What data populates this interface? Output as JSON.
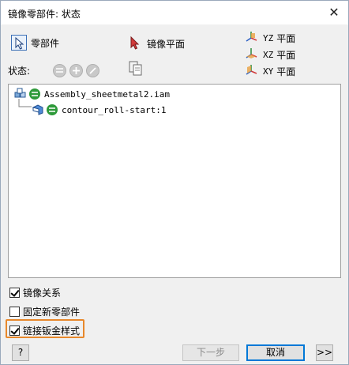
{
  "window": {
    "title": "镜像零部件: 状态",
    "close_glyph": "✕"
  },
  "toolbar": {
    "components_label": "零部件",
    "mirror_plane_label": "镜像平面",
    "status_label": "状态:"
  },
  "planes": [
    {
      "code": "YZ",
      "label": "平面"
    },
    {
      "code": "XZ",
      "label": "平面"
    },
    {
      "code": "XY",
      "label": "平面"
    }
  ],
  "tree": {
    "root": "Assembly_sheetmetal2.iam",
    "child": "contour_roll-start:1"
  },
  "options": {
    "mirror_relations": {
      "label": "镜像关系",
      "checked": true
    },
    "fix_new_components": {
      "label": "固定新零部件",
      "checked": false
    },
    "link_sheetmetal_style": {
      "label": "链接钣金样式",
      "checked": true
    }
  },
  "buttons": {
    "help_glyph": "?",
    "next_label": "下一步",
    "cancel_label": "取消",
    "expand_label": ">>"
  },
  "colors": {
    "highlight": "#e8882b",
    "status_green": "#2e9a3a",
    "select_blue": "#3b6fb6"
  },
  "icons": {
    "components": "select-arrow-icon",
    "mirror_plane": "plane-select-arrow-icon",
    "plane": "axis-triad-icon",
    "status_mirror": "status-mirror-icon",
    "status_reuse": "status-reuse-icon",
    "status_exclude": "status-exclude-icon",
    "copy": "copy-icon",
    "assembly": "assembly-icon",
    "part": "part-icon",
    "mirror_status": "mirror-status-icon",
    "help": "help-icon"
  }
}
